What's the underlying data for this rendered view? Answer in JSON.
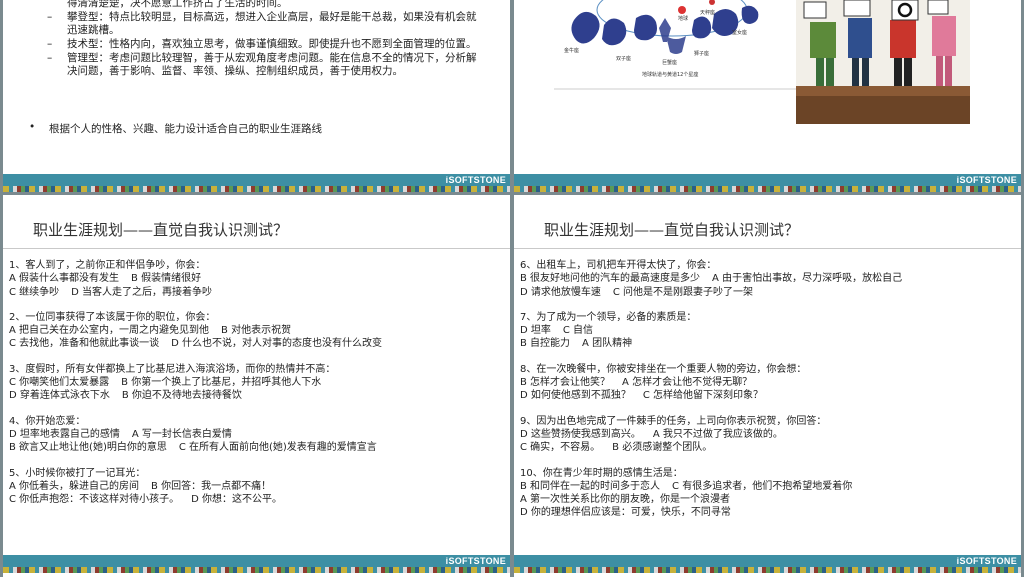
{
  "slide1": {
    "items": [
      "得清清楚楚，决不愿意工作挤占了生活的时间。",
      "攀登型：特点比较明显，目标高远，想进入企业高层，最好是能干总裁，如果没有机会就迅速跳槽。",
      "技术型：性格内向，喜欢独立思考，做事谨慎细致。即使提升也不愿到全面管理的位置。",
      "管理型：考虑问题比较理智，善于从宏观角度考虑问题。能在信息不全的情况下，分析解决问题，善于影响、监督、率领、操纵、控制组织成员，善于使用权力。"
    ],
    "bullet": "根据个人的性格、兴趣、能力设计适合自己的职业生涯路线"
  },
  "slide2": {
    "zodiac_labels": [
      "金牛座",
      "双子座",
      "巨蟹座",
      "狮子座",
      "室女座",
      "地球",
      "天秤座"
    ],
    "caption": "地球轨道与黄道12个星座"
  },
  "footer": {
    "logo": "iSOFTSTONE"
  },
  "slide3": {
    "title": "职业生涯规划——直觉自我认识测试？",
    "questions": [
      {
        "q": "1、客人到了，之前你正和伴侣争吵，你会：",
        "rows": [
          [
            "A 假装什么事都没有发生",
            "B 假装情绪很好"
          ],
          [
            "C 继续争吵",
            "D 当客人走了之后，再接着争吵"
          ]
        ]
      },
      {
        "q": "2、一位同事获得了本该属于你的职位，你会：",
        "rows": [
          [
            "A 把自己关在办公室内，一周之内避免见到他",
            "B 对他表示祝贺"
          ],
          [
            "C 去找他，准备和他就此事谈一谈",
            "D 什么也不说，对人对事的态度也没有什么改变"
          ]
        ]
      },
      {
        "q": "3、度假时，所有女伴都换上了比基尼进入海滨浴场，而你的热情并不高：",
        "rows": [
          [
            "C 你嘲笑他们太爱暴露",
            "B 你第一个换上了比基尼，并招呼其他人下水"
          ],
          [
            "D 穿着连体式泳衣下水",
            "B 你迫不及待地去接待餐饮"
          ]
        ]
      },
      {
        "q": "4、你开始恋爱：",
        "rows": [
          [
            "D 坦率地表露自己的感情",
            "A 写一封长信表白爱情"
          ],
          [
            "B 欲言又止地让他(她)明白你的意思",
            "C 在所有人面前向他(她)发表有趣的爱情宣言"
          ]
        ]
      },
      {
        "q": "5、小时候你被打了一记耳光：",
        "rows": [
          [
            "A 你低着头，躲进自己的房间",
            "B 你回答：我一点都不痛！"
          ],
          [
            "C 你低声抱怨：不该这样对待小孩子。",
            "D 你想：这不公平。"
          ]
        ]
      }
    ]
  },
  "slide4": {
    "title": "职业生涯规划——直觉自我认识测试？",
    "questions": [
      {
        "q": "6、出租车上，司机把车开得太快了，你会：",
        "rows": [
          [
            "B 很友好地问他的汽车的最高速度是多少",
            "A 由于害怕出事故，尽力深呼吸，放松自己"
          ],
          [
            "D 请求他放慢车速",
            "C 问他是不是刚跟妻子吵了一架"
          ]
        ]
      },
      {
        "q": "7、为了成为一个领导，必备的素质是：",
        "rows": [
          [
            "D 坦率",
            "C 自信"
          ],
          [
            "B 自控能力",
            "A 团队精神"
          ]
        ]
      },
      {
        "q": "8、在一次晚餐中，你被安排坐在一个重要人物的旁边，你会想：",
        "rows": [
          [
            "B 怎样才会让他笑？",
            "A 怎样才会让他不觉得无聊？"
          ],
          [
            "D 如何使他感到不孤独？",
            "C 怎样给他留下深刻印象？"
          ]
        ]
      },
      {
        "q": "9、因为出色地完成了一件棘手的任务，上司向你表示祝贺，你回答：",
        "rows": [
          [
            "D 这些赞扬使我感到高兴。",
            "A 我只不过做了我应该做的。"
          ],
          [
            "C 确实，不容易。",
            "B 必须感谢整个团队。"
          ]
        ]
      },
      {
        "q": "10、你在青少年时期的感情生活是：",
        "rows": [
          [
            "B 和同伴在一起的时间多于恋人",
            "C 有很多追求者，他们不抱希望地爱着你"
          ],
          [
            "A 第一次性关系比你的朋友晚，你是一个浪漫者"
          ],
          [
            "D 你的理想伴侣应该是：可爱，快乐，不同寻常"
          ]
        ]
      }
    ]
  }
}
